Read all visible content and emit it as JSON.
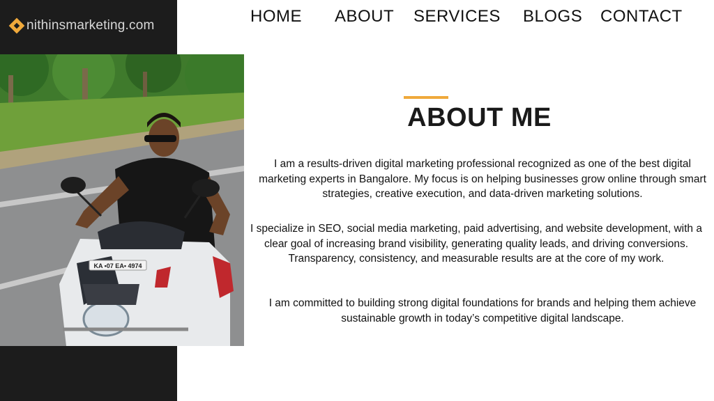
{
  "brand": {
    "name": "nithinsmarketing.com"
  },
  "nav": {
    "items": [
      "HOME",
      "ABOUT",
      "SERVICES",
      "BLOGS",
      "CONTACT"
    ]
  },
  "about": {
    "title": "ABOUT ME",
    "paragraphs": [
      "I am a results-driven digital marketing professional recognized as one of the best digital marketing experts in Bangalore. My focus is on helping businesses grow online through smart strategies, creative execution, and data-driven marketing solutions.",
      "I specialize in SEO, social media marketing, paid advertising, and website development, with a clear goal of increasing brand visibility, generating quality leads, and driving conversions. Transparency, consistency, and measurable results are at the core of my work.",
      "I am committed to building strong digital foundations for brands and helping them achieve sustainable growth in today’s competitive digital landscape."
    ]
  },
  "photo": {
    "plate_text": "KA •07 EA• 4974"
  },
  "colors": {
    "accent": "#f0a93b",
    "dark": "#1c1c1c"
  }
}
